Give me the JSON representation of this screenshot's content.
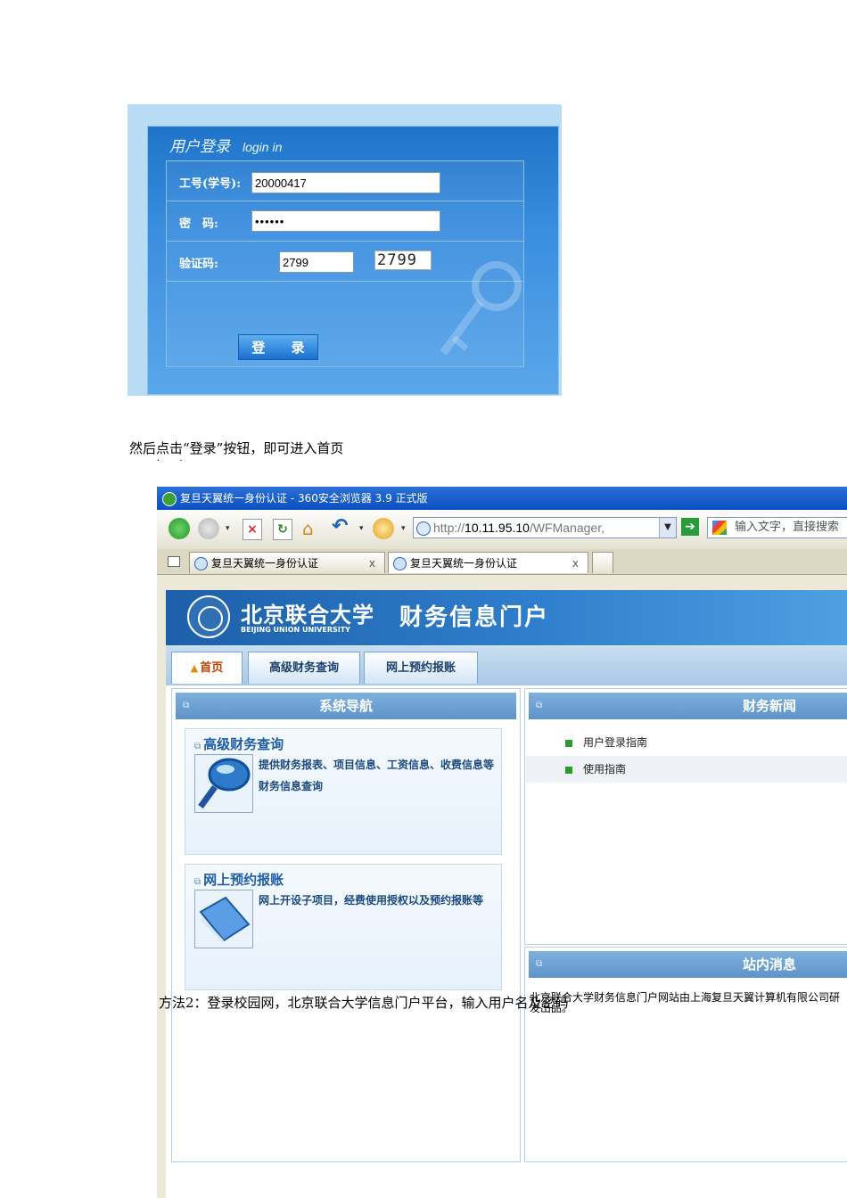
{
  "login": {
    "title": "用户登录",
    "title_en": "login in",
    "id_label": "工号(学号):",
    "id_value": "20000417",
    "pwd_label": "密　码:",
    "pwd_value": "••••••",
    "captcha_label": "验证码:",
    "captcha_value": "2799",
    "captcha_image_text": "2799",
    "submit_label": "登 录"
  },
  "caption1": "然后点击“登录”按钮，即可进入首页",
  "caption1_dots": "·       ·",
  "browser": {
    "window_title": "复旦天翼统一身份认证 - 360安全浏览器 3.9 正式版",
    "url_prefix": "http://",
    "url_host": "10.11.95.10",
    "url_path": "/WFManager,",
    "search_placeholder": "输入文字，直接搜索",
    "tabs": [
      {
        "label": "复旦天翼统一身份认证",
        "close": "x"
      },
      {
        "label": "复旦天翼统一身份认证",
        "close": "x"
      }
    ]
  },
  "portal": {
    "university_cn": "北京联合大学",
    "university_en": "BEIJING UNION UNIVERSITY",
    "portal_title": "财务信息门户",
    "nav": [
      "首页",
      "高级财务查询",
      "网上预约报账"
    ],
    "nav_panel_title": "系统导航",
    "cards": [
      {
        "title": "高级财务查询",
        "desc": "提供财务报表、项目信息、工资信息、收费信息等财务信息查询"
      },
      {
        "title": "网上预约报账",
        "desc": "网上开设子项目，经费使用授权以及预约报账等"
      }
    ],
    "news_title": "财务新闻",
    "news_items": [
      "用户登录指南",
      "使用指南"
    ],
    "messages_title": "站内消息"
  },
  "caption2_left": "方法2：登录校园网，北京联合大学信息门户平台，输入用户名及密码",
  "caption2_right": "北京联合大学财务信息门户网站由上海复旦天翼计算机有限公司研发出品。",
  "colors": {
    "accent": "#2f7fcd",
    "header_dark": "#1d5fa9",
    "link": "#1f5ea6"
  }
}
